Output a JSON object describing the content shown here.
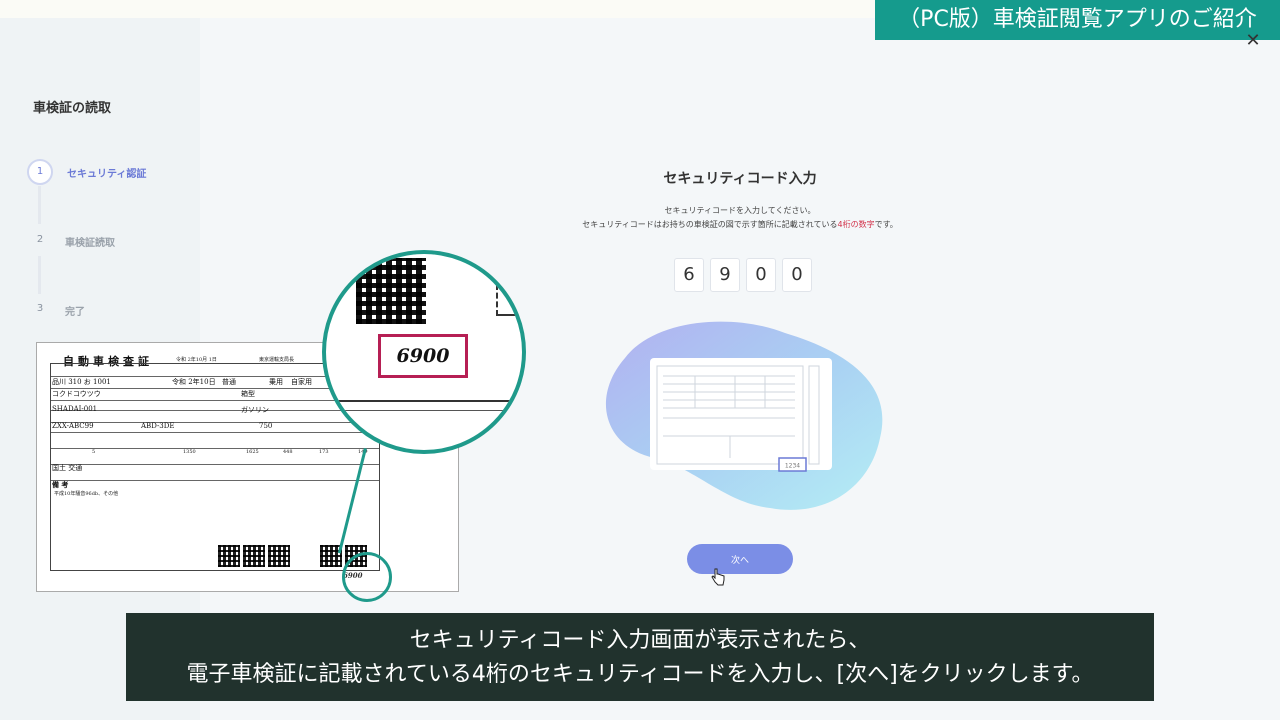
{
  "banner": {
    "text": "（PC版）車検証閲覧アプリのご紹介"
  },
  "sidebar": {
    "title": "車検証の読取",
    "steps": [
      {
        "num": "1",
        "label": "セキュリティ認証"
      },
      {
        "num": "2",
        "label": "車検証読取"
      },
      {
        "num": "3",
        "label": "完了"
      }
    ]
  },
  "main": {
    "title": "セキュリティコード入力",
    "desc_line1": "セキュリティコードを入力してください。",
    "desc_line2_pre": "セキュリティコードはお持ちの車検証の図で示す箇所に記載されている",
    "desc_line2_highlight": "4桁の数字",
    "desc_line2_post": "です。",
    "code_digits": [
      "6",
      "9",
      "0",
      "0"
    ],
    "next_button": "次へ",
    "illustration_code": "1234"
  },
  "document": {
    "title": "自動車検査証",
    "date": "令和 2年10月 1日",
    "office": "東京運輸支局長",
    "plate": "品川 310 お 1001",
    "reg_date": "令和 2年10日",
    "usage": "普通",
    "type": "乗用",
    "purpose": "自家用",
    "owner": "コクドコウツウ",
    "shape": "箱型",
    "chassis": "SHADAI-001",
    "fuel": "ガソリン",
    "model": "ZXX-ABC99",
    "engine": "ABD-3DE",
    "capacity": "5",
    "weight": "1350",
    "gross": "1625",
    "length": "448",
    "width": "173",
    "height": "149",
    "displacement": "750",
    "user_place": "国土 交通",
    "remarks_title": "備 考",
    "remarks": "平成10年騒音96db、その他",
    "security_code": "6900"
  },
  "caption": {
    "line1": "セキュリティコード入力画面が表示されたら、",
    "line2": "電子車検証に記載されている4桁のセキュリティコードを入力し、[次へ]をクリックします。"
  },
  "colors": {
    "accent": "#7b8ee6",
    "banner": "#159b8d",
    "highlight": "#d2334b",
    "magnifier": "#1f9a8b",
    "caption_bg": "#21322d"
  }
}
